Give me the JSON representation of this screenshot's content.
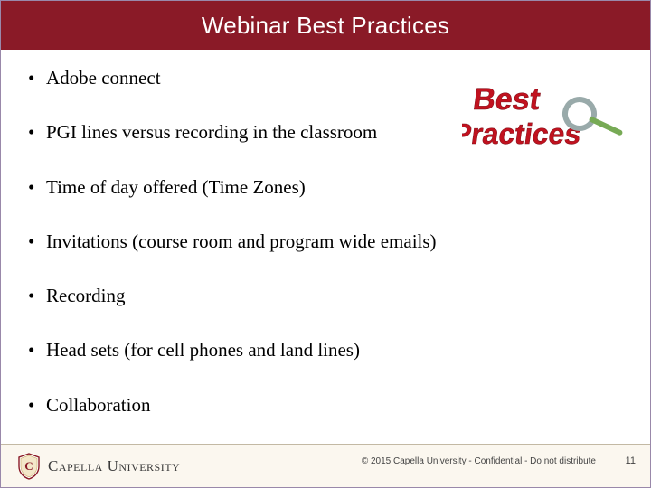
{
  "title": "Webinar Best Practices",
  "bullets": [
    "Adobe connect",
    "PGI lines versus recording in the classroom",
    "Time of day offered (Time Zones)",
    "Invitations (course room and program wide emails)",
    "Recording",
    "Head sets (for cell phones and land lines)",
    "Collaboration"
  ],
  "decor": {
    "graphic_label": "Best Practices"
  },
  "footer": {
    "org_name": "Capella University",
    "disclaimer": "© 2015 Capella University - Confidential - Do not distribute",
    "page_number": "11"
  }
}
